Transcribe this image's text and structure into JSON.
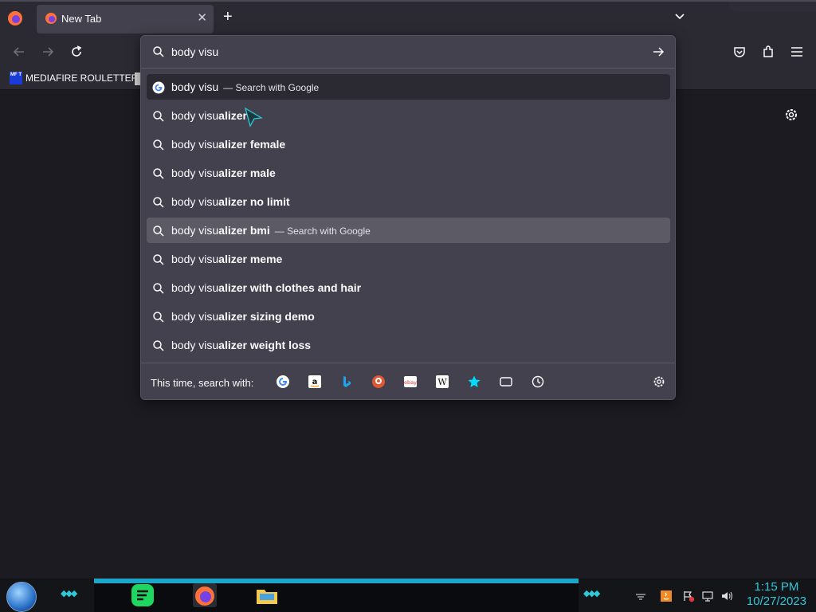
{
  "browser": {
    "tab_title": "New Tab",
    "url_value": "body visu"
  },
  "bookmarks": [
    {
      "label": "MEDIAFIRE ROULETTER",
      "icon": "mediafire-icon",
      "icon_text": "MF T"
    }
  ],
  "dropdown": {
    "suggestions": [
      {
        "icon": "google-icon",
        "typed": "body visu",
        "completion": "",
        "action": "Search with Google"
      },
      {
        "icon": "search-icon",
        "typed": "body visu",
        "completion": "alizer",
        "action": ""
      },
      {
        "icon": "search-icon",
        "typed": "body visu",
        "completion": "alizer female",
        "action": ""
      },
      {
        "icon": "search-icon",
        "typed": "body visu",
        "completion": "alizer male",
        "action": ""
      },
      {
        "icon": "search-icon",
        "typed": "body visu",
        "completion": "alizer no limit",
        "action": ""
      },
      {
        "icon": "search-icon",
        "typed": "body visu",
        "completion": "alizer bmi",
        "action": "Search with Google"
      },
      {
        "icon": "search-icon",
        "typed": "body visu",
        "completion": "alizer meme",
        "action": ""
      },
      {
        "icon": "search-icon",
        "typed": "body visu",
        "completion": "alizer with clothes and hair",
        "action": ""
      },
      {
        "icon": "search-icon",
        "typed": "body visu",
        "completion": "alizer sizing demo",
        "action": ""
      },
      {
        "icon": "search-icon",
        "typed": "body visu",
        "completion": "alizer weight loss",
        "action": ""
      }
    ],
    "footer_label": "This time, search with:",
    "engines": [
      "google-icon",
      "amazon-icon",
      "bing-icon",
      "duckduckgo-icon",
      "ebay-icon",
      "wikipedia-icon",
      "bookmarks-star-icon",
      "tabs-icon",
      "history-icon"
    ]
  },
  "taskbar": {
    "time": "1:15 PM",
    "date": "10/27/2023"
  },
  "colors": {
    "accent_teal": "#2fc7d9",
    "popup_bg": "#42414d",
    "chrome_bg": "#2b2a33"
  }
}
